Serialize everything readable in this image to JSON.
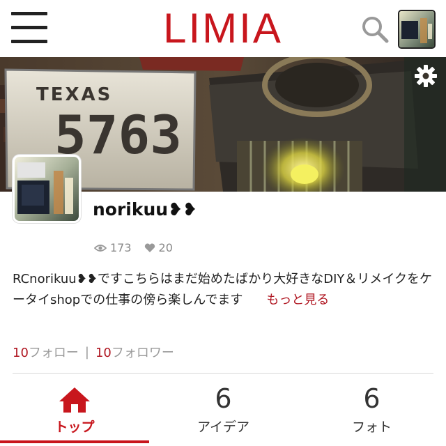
{
  "header": {
    "logo": "LIMIA",
    "icons": [
      "menu-icon",
      "search-icon"
    ]
  },
  "cover": {
    "plate_state": "TEXAS",
    "plate_number": "5763",
    "settings_icon": "gear-icon"
  },
  "profile": {
    "name": "norikuu❥❥",
    "views": "173",
    "likes": "20",
    "bio_text": "RCnorikuu❥❥ですこちらはまだ始めたばかり大好きなDIY＆リメイクをケータイshopでの仕事の傍ら楽しんでます",
    "more_label": "もっと見る"
  },
  "follows": {
    "follow_count": "10",
    "follow_label": "フォロー",
    "separator": "|",
    "follower_count": "10",
    "follower_label": "フォロワー"
  },
  "tabs": [
    {
      "label": "トップ",
      "icon": "home-icon",
      "active": true
    },
    {
      "label": "アイデア",
      "count": "6"
    },
    {
      "label": "フォト",
      "count": "6"
    }
  ],
  "colors": {
    "brand": "#c8161d",
    "link": "#b01722",
    "muted": "#888888"
  }
}
